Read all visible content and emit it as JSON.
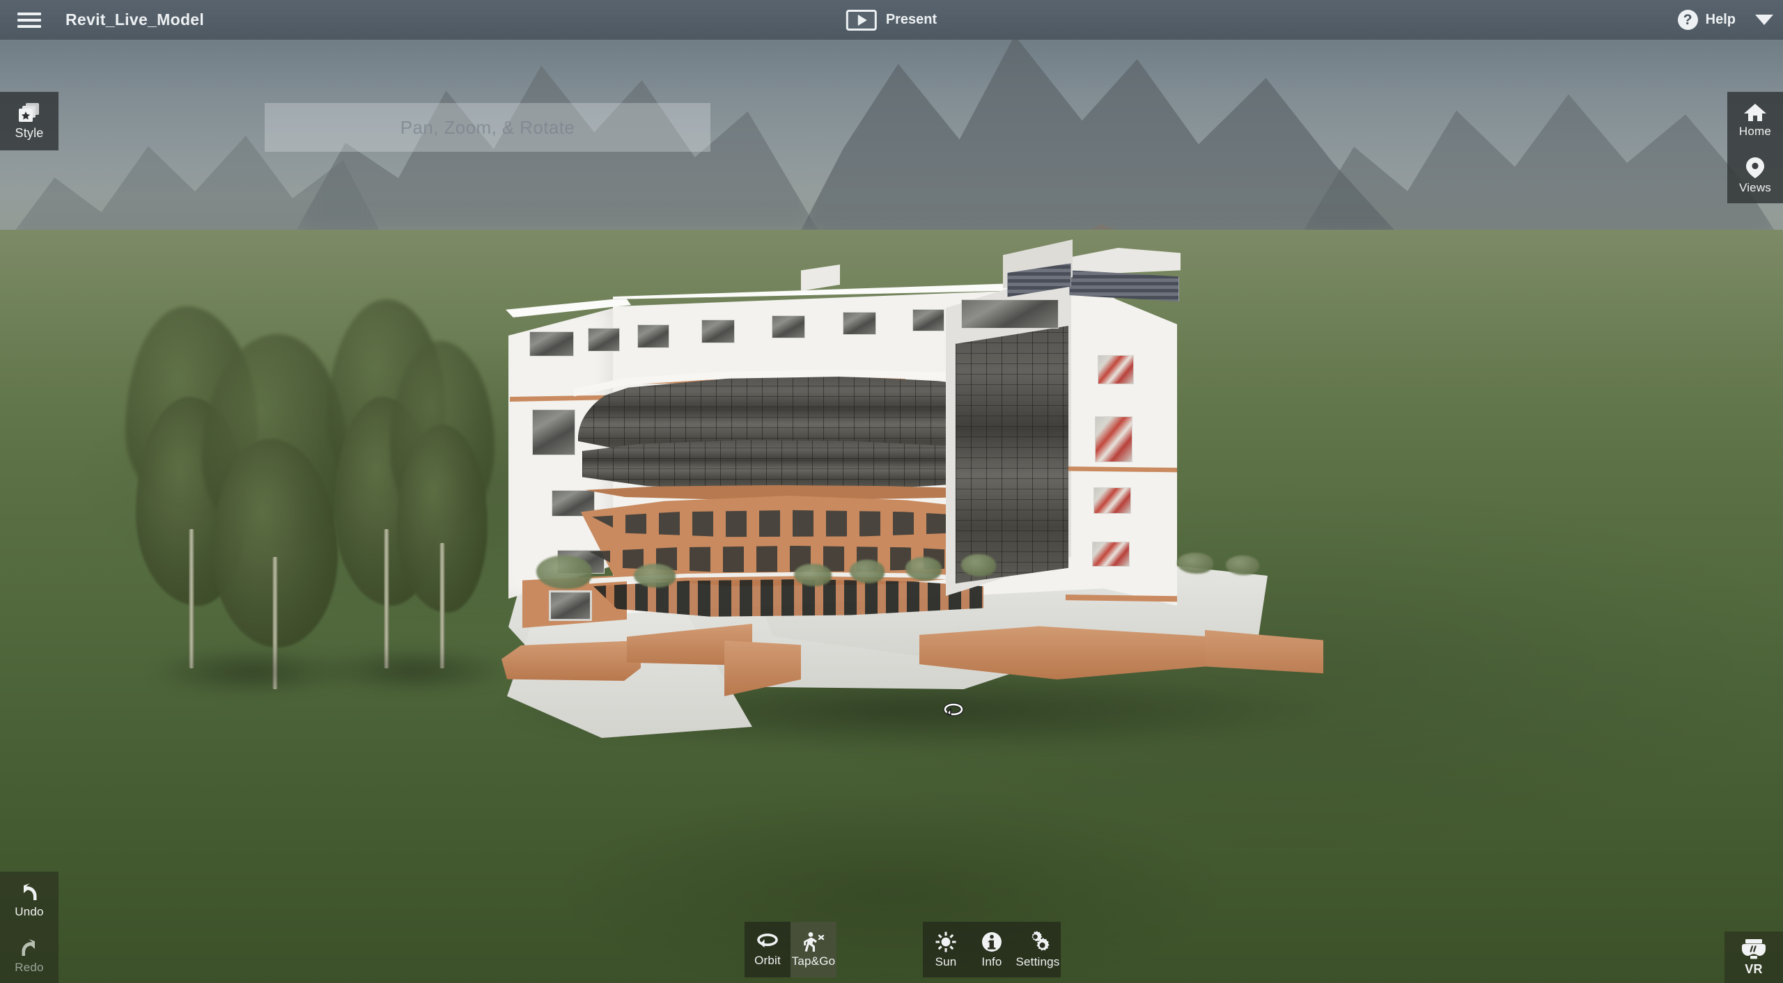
{
  "header": {
    "menu_icon": "hamburger-menu-icon",
    "title": "Revit_Live_Model",
    "present": {
      "label": "Present",
      "icon": "play-video-icon"
    },
    "help": {
      "label": "Help",
      "icon": "question-mark-circle-icon"
    },
    "caret": {
      "icon": "chevron-down-icon"
    }
  },
  "viewport": {
    "hint_overlay": "Pan, Zoom, & Rotate",
    "cursor_icon": "orbit-rotate-cursor-icon",
    "scene": {
      "model_name": "Revit_Live_Model",
      "sky_color": "#8d979b",
      "ground_color": "#546b3f",
      "building_wall_color": "#f3f2ef",
      "building_accent_color": "#c98a5f",
      "glass_color": "#4b4a47",
      "roof_louver_color": "#4a4e58",
      "plaza_color": "#e6e6e2"
    }
  },
  "left_top_panel": {
    "items": [
      {
        "label": "Style",
        "icon": "style-cards-star-icon",
        "enabled": true
      }
    ]
  },
  "right_top_panel": {
    "items": [
      {
        "label": "Home",
        "icon": "home-house-icon",
        "enabled": true
      },
      {
        "label": "Views",
        "icon": "map-pin-views-icon",
        "enabled": true
      }
    ]
  },
  "bottom_left_panel": {
    "items": [
      {
        "label": "Undo",
        "icon": "undo-curved-arrow-icon",
        "enabled": true
      },
      {
        "label": "Redo",
        "icon": "redo-curved-arrow-icon",
        "enabled": false
      }
    ]
  },
  "bottom_nav_panel": {
    "items": [
      {
        "label": "Orbit",
        "icon": "orbit-rotate-icon",
        "active": false
      },
      {
        "label": "Tap&Go",
        "icon": "walking-person-icon",
        "active": true
      }
    ]
  },
  "bottom_options_panel": {
    "items": [
      {
        "label": "Sun",
        "icon": "sun-rays-icon"
      },
      {
        "label": "Info",
        "icon": "info-circle-icon"
      },
      {
        "label": "Settings",
        "icon": "gears-settings-icon"
      }
    ]
  },
  "bottom_right_panel": {
    "items": [
      {
        "label": "VR",
        "icon": "vr-headset-icon",
        "enabled": true
      }
    ]
  }
}
